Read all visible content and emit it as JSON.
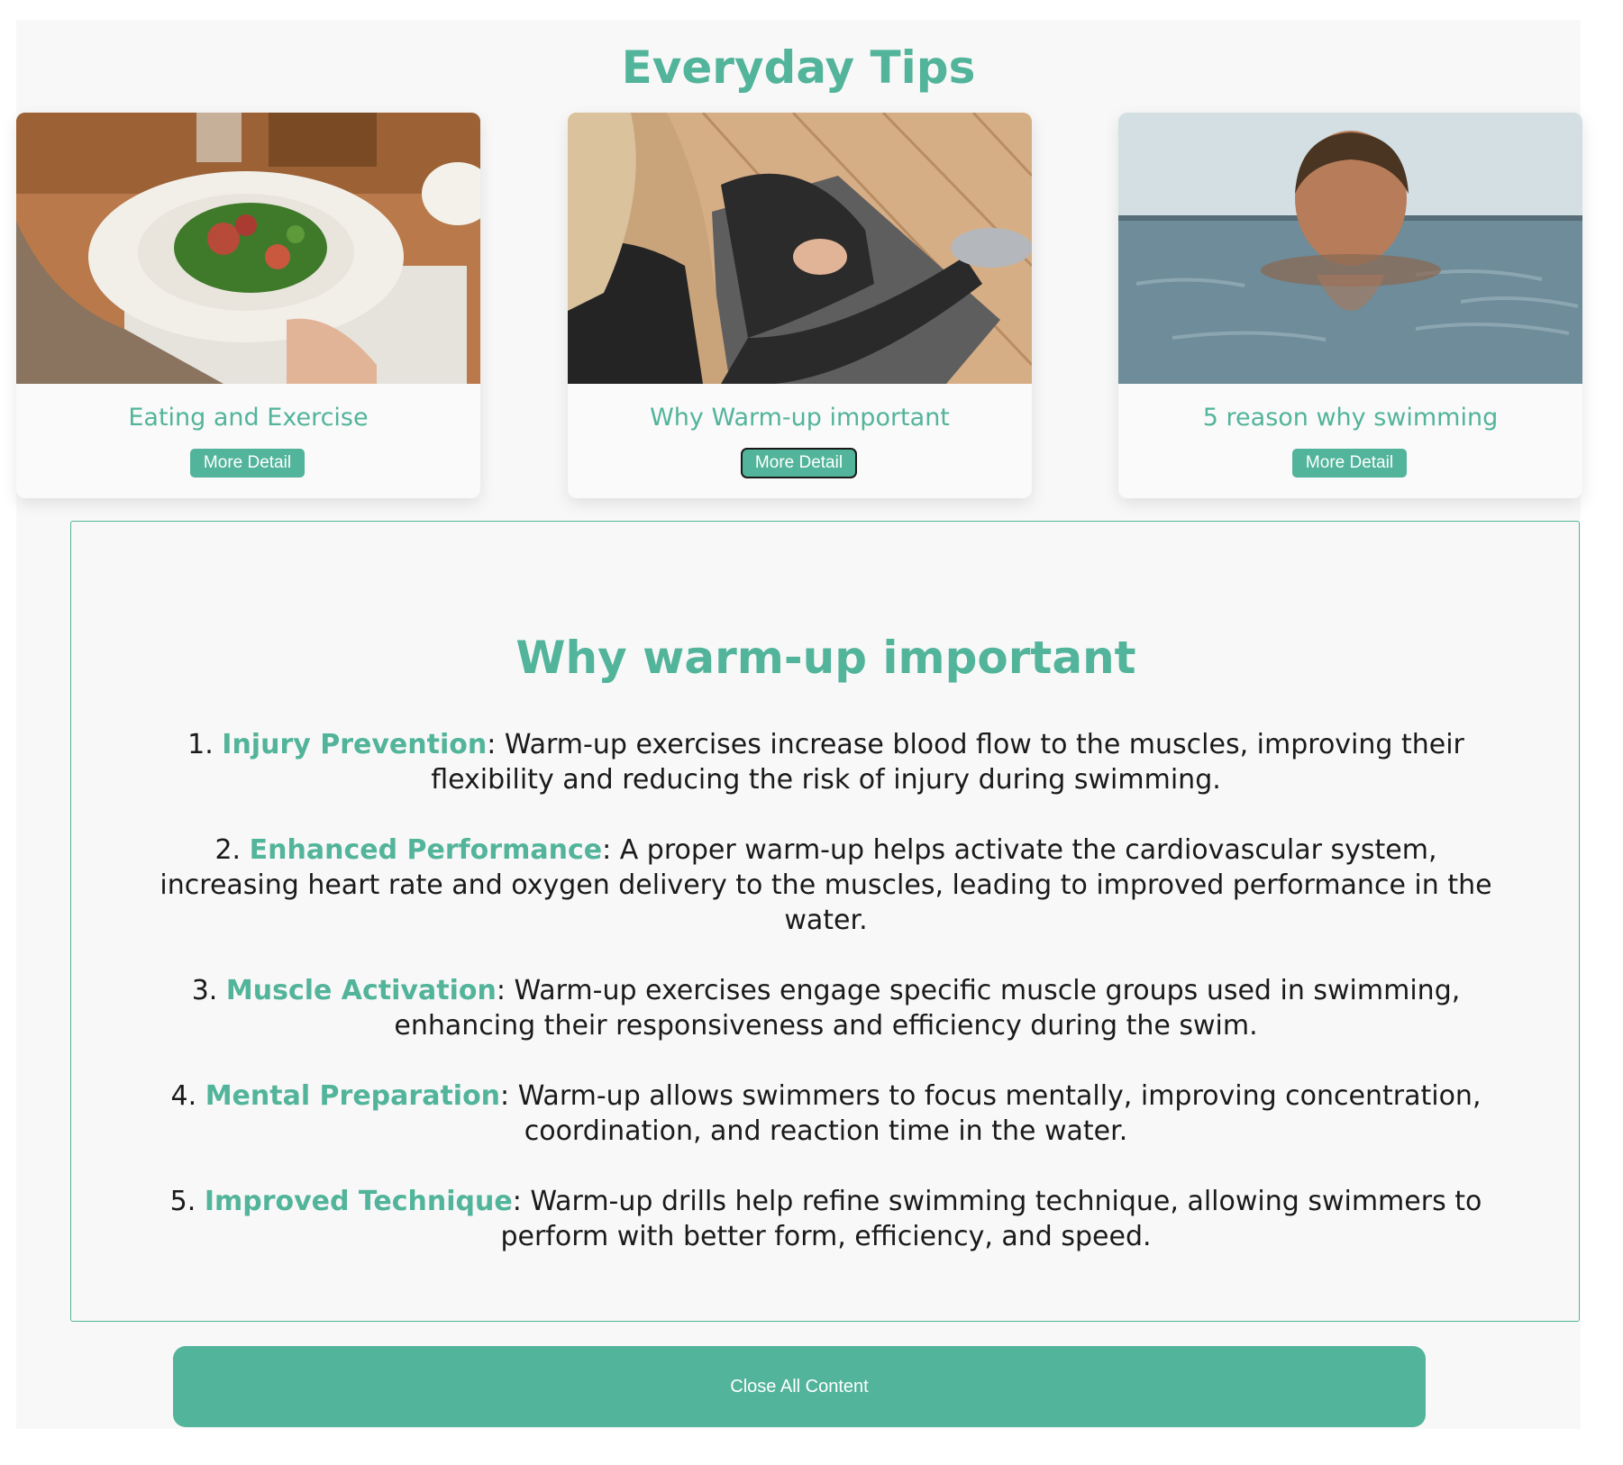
{
  "page": {
    "title": "Everyday Tips"
  },
  "cards": [
    {
      "title": "Eating and Exercise",
      "button_label": "More Detail",
      "image": "salad-plate-photo"
    },
    {
      "title": "Why Warm-up important",
      "button_label": "More Detail",
      "image": "woman-stretching-photo",
      "focused": true
    },
    {
      "title": "5 reason why swimming",
      "button_label": "More Detail",
      "image": "woman-swimming-photo"
    }
  ],
  "detail": {
    "heading": "Why warm-up important",
    "items": [
      {
        "number": "1.",
        "term": "Injury Prevention",
        "text": ": Warm-up exercises increase blood flow to the muscles, improving their flexibility and reducing the risk of injury during swimming."
      },
      {
        "number": "2.",
        "term": "Enhanced Performance",
        "text": ": A proper warm-up helps activate the cardiovascular system, increasing heart rate and oxygen delivery to the muscles, leading to improved performance in the water."
      },
      {
        "number": "3.",
        "term": "Muscle Activation",
        "text": ": Warm-up exercises engage specific muscle groups used in swimming, enhancing their responsiveness and efficiency during the swim."
      },
      {
        "number": "4.",
        "term": "Mental Preparation",
        "text": ": Warm-up allows swimmers to focus mentally, improving concentration, coordination, and reaction time in the water."
      },
      {
        "number": "5.",
        "term": "Improved Technique",
        "text": ": Warm-up drills help refine swimming technique, allowing swimmers to perform with better form, efficiency, and speed."
      }
    ]
  },
  "close_button": {
    "label": "Close All Content"
  },
  "colors": {
    "accent": "#52b49a",
    "background": "#f8f8f8",
    "text": "#1a1a1a"
  }
}
